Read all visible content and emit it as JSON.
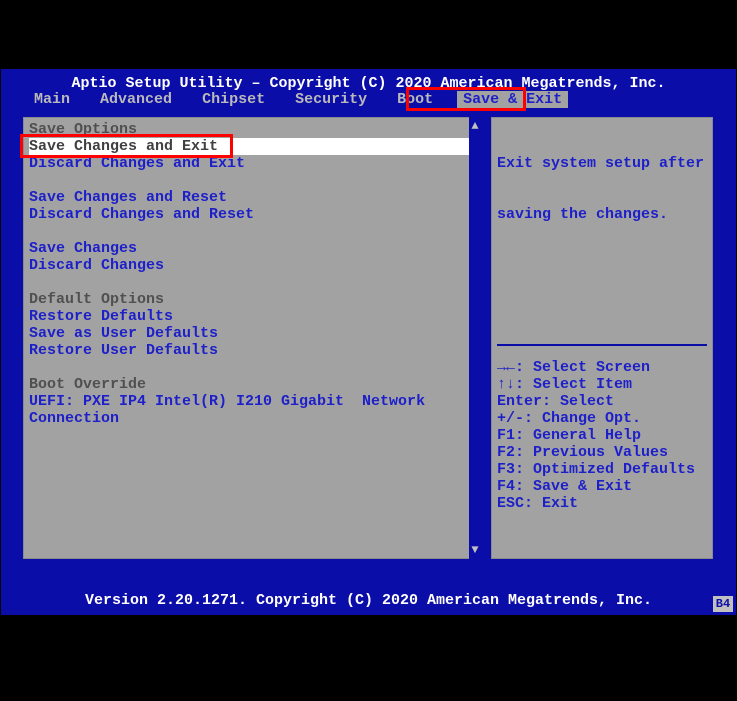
{
  "title": "Aptio Setup Utility – Copyright (C) 2020 American Megatrends, Inc.",
  "version": "Version 2.20.1271. Copyright (C) 2020 American Megatrends, Inc.",
  "corner_badge": "B4",
  "menubar": {
    "items": [
      {
        "label": "Main"
      },
      {
        "label": "Advanced"
      },
      {
        "label": "Chipset"
      },
      {
        "label": "Security"
      },
      {
        "label": "Boot"
      },
      {
        "label": "Save & Exit"
      }
    ],
    "active_index": 5
  },
  "left_panel": {
    "lines": [
      {
        "text": "Save Options",
        "kind": "head"
      },
      {
        "text": "Save Changes and Exit",
        "kind": "sel"
      },
      {
        "text": "Discard Changes and Exit",
        "kind": "opt"
      },
      {
        "text": "",
        "kind": "blank"
      },
      {
        "text": "Save Changes and Reset",
        "kind": "opt"
      },
      {
        "text": "Discard Changes and Reset",
        "kind": "opt"
      },
      {
        "text": "",
        "kind": "blank"
      },
      {
        "text": "Save Changes",
        "kind": "opt"
      },
      {
        "text": "Discard Changes",
        "kind": "opt"
      },
      {
        "text": "",
        "kind": "blank"
      },
      {
        "text": "Default Options",
        "kind": "head"
      },
      {
        "text": "Restore Defaults",
        "kind": "opt"
      },
      {
        "text": "Save as User Defaults",
        "kind": "opt"
      },
      {
        "text": "Restore User Defaults",
        "kind": "opt"
      },
      {
        "text": "",
        "kind": "blank"
      },
      {
        "text": "Boot Override",
        "kind": "head"
      },
      {
        "text": "UEFI: PXE IP4 Intel(R) I210 Gigabit  Network",
        "kind": "opt"
      },
      {
        "text": "Connection",
        "kind": "opt"
      }
    ],
    "scroll_up_glyph": "▲",
    "scroll_down_glyph": "▼"
  },
  "right_panel": {
    "help_text_line1": "Exit system setup after",
    "help_text_line2": "saving the changes.",
    "key_help": [
      "→←: Select Screen",
      "↑↓: Select Item",
      "Enter: Select",
      "+/-: Change Opt.",
      "F1: General Help",
      "F2: Previous Values",
      "F3: Optimized Defaults",
      "F4: Save & Exit",
      "ESC: Exit"
    ]
  }
}
